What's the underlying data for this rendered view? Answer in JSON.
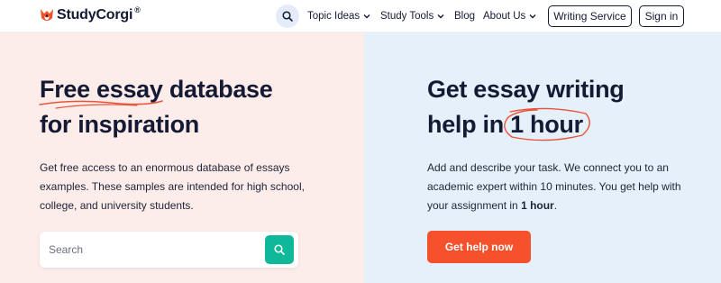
{
  "brand": {
    "name": "StudyCorgi",
    "reg": "®",
    "accent": "#f4512c"
  },
  "nav": {
    "search_icon": "search-icon",
    "topic_ideas": "Topic Ideas",
    "study_tools": "Study Tools",
    "blog": "Blog",
    "about_us": "About Us",
    "writing_service": "Writing Service",
    "sign_in": "Sign in"
  },
  "left": {
    "headline_mark": "Free essay",
    "headline_rest1": " database",
    "headline_line2": "for inspiration",
    "description": "Get free access to an enormous database of essays examples. These samples are intended for high school, college, and university students.",
    "search_placeholder": "Search",
    "search_value": ""
  },
  "right": {
    "headline_line1": "Get essay writing",
    "headline_pre": "help in ",
    "headline_mark": "1 hour",
    "description_pre": "Add and describe your task. We connect you to an academic expert within 10 minutes. You get help with your assignment in ",
    "description_bold": "1 hour",
    "description_post": ".",
    "cta": "Get help now"
  },
  "colors": {
    "left_bg": "#fcecea",
    "right_bg": "#e6f0fa",
    "search_button": "#10b89a",
    "cta_button": "#f4512c",
    "highlight_stroke": "#e8553b"
  }
}
